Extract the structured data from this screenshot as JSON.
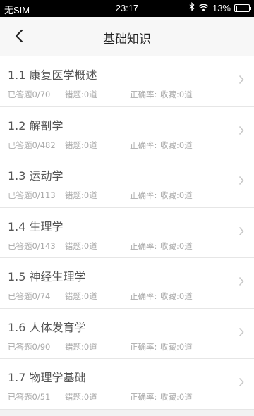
{
  "status_bar": {
    "carrier": "无SIM",
    "time": "23:17",
    "battery": "13%",
    "battery_level": 0.13
  },
  "nav": {
    "title": "基础知识",
    "back_icon": "chevron-left-icon"
  },
  "items": [
    {
      "title": "1.1 康复医学概述",
      "answered": "已答题0/70",
      "wrong": "错题:0道",
      "accuracy": "正确率:",
      "favorites": "收藏:0道"
    },
    {
      "title": "1.2 解剖学",
      "answered": "已答题0/482",
      "wrong": "错题:0道",
      "accuracy": "正确率:",
      "favorites": "收藏:0道"
    },
    {
      "title": "1.3 运动学",
      "answered": "已答题0/113",
      "wrong": "错题:0道",
      "accuracy": "正确率:",
      "favorites": "收藏:0道"
    },
    {
      "title": "1.4 生理学",
      "answered": "已答题0/143",
      "wrong": "错题:0道",
      "accuracy": "正确率:",
      "favorites": "收藏:0道"
    },
    {
      "title": "1.5 神经生理学",
      "answered": "已答题0/74",
      "wrong": "错题:0道",
      "accuracy": "正确率:",
      "favorites": "收藏:0道"
    },
    {
      "title": "1.6 人体发育学",
      "answered": "已答题0/90",
      "wrong": "错题:0道",
      "accuracy": "正确率:",
      "favorites": "收藏:0道"
    },
    {
      "title": "1.7 物理学基础",
      "answered": "已答题0/51",
      "wrong": "错题:0道",
      "accuracy": "正确率:",
      "favorites": "收藏:0道"
    }
  ],
  "colors": {
    "status_bg": "#000000",
    "nav_bg": "#f7f7f7",
    "item_bg": "#ffffff",
    "title_text": "#555555",
    "stat_text": "#aaaaaa",
    "chevron": "#c8c8c8"
  }
}
